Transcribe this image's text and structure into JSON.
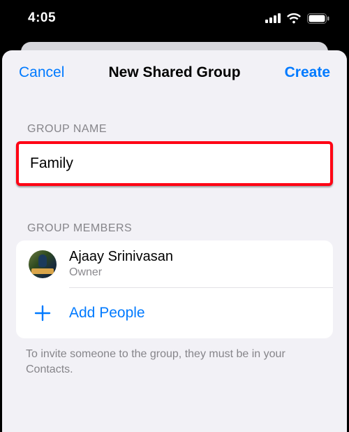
{
  "status": {
    "time": "4:05"
  },
  "sheet": {
    "cancel_label": "Cancel",
    "title": "New Shared Group",
    "create_label": "Create"
  },
  "group_name": {
    "section_label": "GROUP NAME",
    "value": "Family"
  },
  "members": {
    "section_label": "GROUP MEMBERS",
    "list": [
      {
        "name": "Ajaay Srinivasan",
        "role": "Owner"
      }
    ],
    "add_label": "Add People",
    "footer": "To invite someone to the group, they must be in your Contacts."
  },
  "colors": {
    "accent": "#007aff",
    "highlight_border": "#ff0014",
    "bg": "#f2f1f6"
  }
}
